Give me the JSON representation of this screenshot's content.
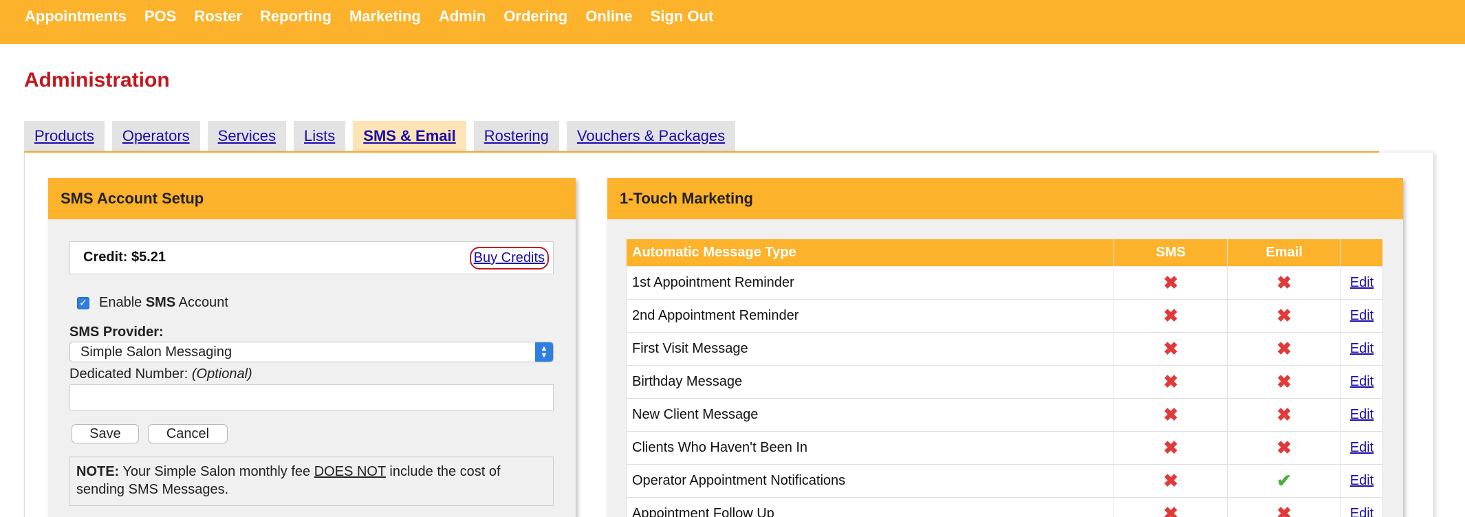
{
  "nav": {
    "items": [
      "Appointments",
      "POS",
      "Roster",
      "Reporting",
      "Marketing",
      "Admin",
      "Ordering",
      "Online",
      "Sign Out"
    ]
  },
  "page": {
    "title": "Administration"
  },
  "tabs": [
    {
      "label": "Products",
      "active": false
    },
    {
      "label": "Operators",
      "active": false
    },
    {
      "label": "Services",
      "active": false
    },
    {
      "label": "Lists",
      "active": false
    },
    {
      "label": "SMS & Email",
      "active": true
    },
    {
      "label": "Rostering",
      "active": false
    },
    {
      "label": "Vouchers & Packages",
      "active": false
    }
  ],
  "sms_setup": {
    "title": "SMS Account Setup",
    "credit": "Credit: $5.21",
    "buy_credits": "Buy Credits",
    "enable_prefix": "Enable ",
    "enable_bold": "SMS",
    "enable_suffix": " Account",
    "enabled": true,
    "provider_label": "SMS Provider:",
    "provider_value": "Simple Salon Messaging",
    "dedicated_label": "Dedicated Number: ",
    "dedicated_optional": "(Optional)",
    "dedicated_value": "",
    "save_label": "Save",
    "cancel_label": "Cancel",
    "note_bold": "NOTE:",
    "note_text1": " Your Simple Salon monthly fee ",
    "note_underline": "DOES NOT",
    "note_text2": " include the cost of sending SMS Messages."
  },
  "marketing": {
    "title": "1-Touch Marketing",
    "headers": {
      "type": "Automatic Message Type",
      "sms": "SMS",
      "email": "Email",
      "edit": ""
    },
    "edit_label": "Edit",
    "rows": [
      {
        "type": "1st Appointment Reminder",
        "sms": false,
        "email": false
      },
      {
        "type": "2nd Appointment Reminder",
        "sms": false,
        "email": false
      },
      {
        "type": "First Visit Message",
        "sms": false,
        "email": false
      },
      {
        "type": "Birthday Message",
        "sms": false,
        "email": false
      },
      {
        "type": "New Client Message",
        "sms": false,
        "email": false
      },
      {
        "type": "Clients Who Haven't Been In",
        "sms": false,
        "email": false
      },
      {
        "type": "Operator Appointment Notifications",
        "sms": false,
        "email": true
      },
      {
        "type": "Appointment Follow Up",
        "sms": false,
        "email": false
      }
    ]
  },
  "colors": {
    "accent": "#fdb22b",
    "title_red": "#c4171c",
    "link": "#1a0dab",
    "cross": "#e23a3a",
    "check": "#4cae3b"
  }
}
